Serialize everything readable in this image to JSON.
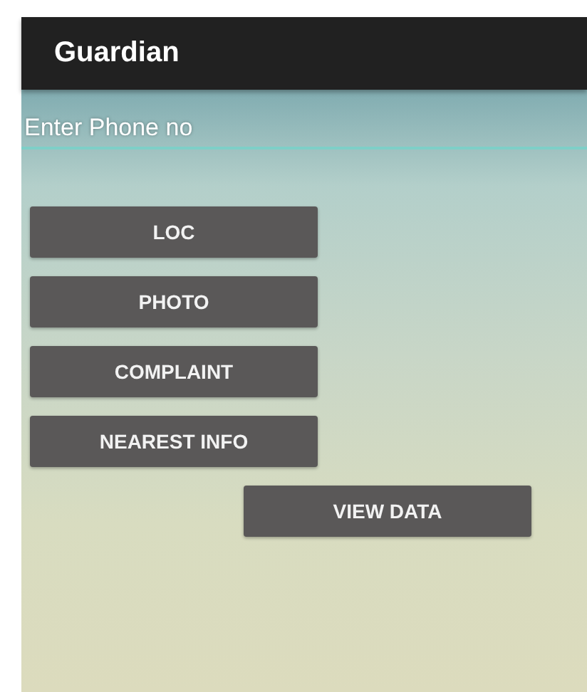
{
  "app_bar": {
    "title": "Guardian"
  },
  "phone_field": {
    "placeholder": "Enter Phone no"
  },
  "buttons": [
    {
      "label": "LOC",
      "kind": "left"
    },
    {
      "label": "PHOTO",
      "kind": "left"
    },
    {
      "label": "COMPLAINT",
      "kind": "left"
    },
    {
      "label": "NEAREST INFO",
      "kind": "left"
    },
    {
      "label": "VIEW DATA",
      "kind": "right"
    }
  ]
}
